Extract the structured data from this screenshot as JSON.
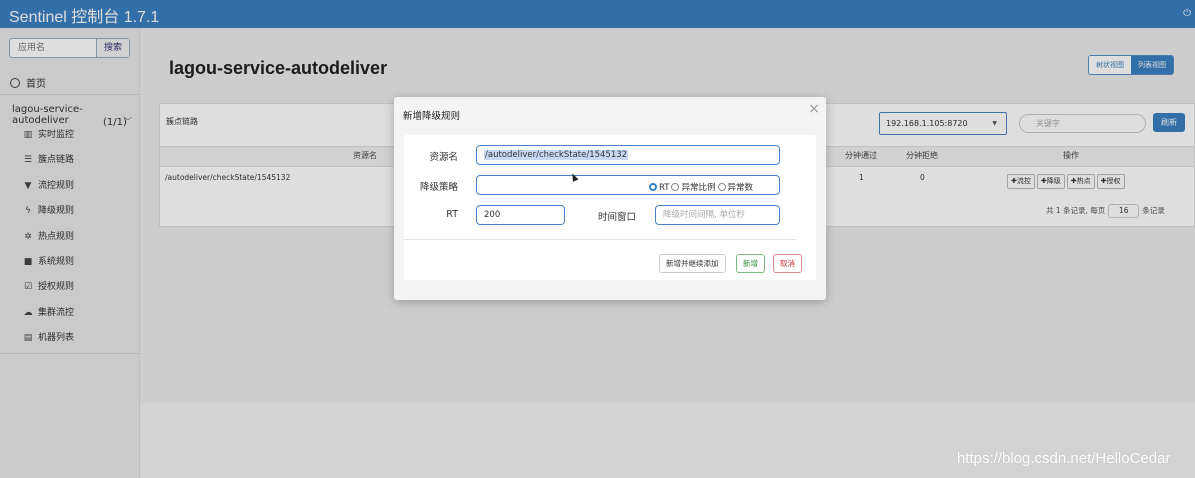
{
  "header": {
    "brand": "Sentinel 控制台 1.7.1",
    "logout_icon": "logout-icon"
  },
  "sidebar": {
    "search_placeholder": "应用名",
    "search_button": "搜索",
    "home": "首页",
    "app_name": "lagou-service-autodeliver",
    "app_count": "(1/1)",
    "items": [
      {
        "label": "实时监控",
        "icon": "bar-chart-icon"
      },
      {
        "label": "簇点链路",
        "icon": "list-icon"
      },
      {
        "label": "流控规则",
        "icon": "filter-icon"
      },
      {
        "label": "降级规则",
        "icon": "flash-icon"
      },
      {
        "label": "热点规则",
        "icon": "fire-icon"
      },
      {
        "label": "系统规则",
        "icon": "lock-icon"
      },
      {
        "label": "授权规则",
        "icon": "check-icon"
      },
      {
        "label": "集群流控",
        "icon": "cloud-icon"
      },
      {
        "label": "机器列表",
        "icon": "table-icon"
      }
    ]
  },
  "main": {
    "title": "lagou-service-autodeliver",
    "view_tree": "树状视图",
    "view_list": "列表视图",
    "panel_title": "簇点链路",
    "machine": "192.168.1.105:8720",
    "keyword_placeholder": "关键字",
    "refresh": "刷新",
    "columns": {
      "resource": "资源名",
      "pass": "分钟通过",
      "reject": "分钟拒绝",
      "ops": "操作"
    },
    "row": {
      "resource": "/autodeliver/checkState/1545132",
      "pass": "1",
      "reject": "0"
    },
    "op_buttons": [
      "✚流控",
      "✚降级",
      "✚热点",
      "✚授权"
    ],
    "pager_prefix": "共 1 条记录, 每页",
    "page_size": "16",
    "pager_suffix": "条记录"
  },
  "modal": {
    "title": "新增降级规则",
    "close": "×",
    "resource_label": "资源名",
    "resource_value": "/autodeliver/checkState/1545132",
    "strategy_label": "降级策略",
    "strategies": [
      "RT",
      "异常比例",
      "异常数"
    ],
    "selected_strategy": "RT",
    "rt_label": "RT",
    "rt_value": "200",
    "window_label": "时间窗口",
    "window_placeholder": "降级时间间隔, 单位秒",
    "btn_continue": "新增并继续添加",
    "btn_add": "新增",
    "btn_cancel": "取消"
  },
  "watermark": "https://blog.csdn.net/HelloCedar"
}
